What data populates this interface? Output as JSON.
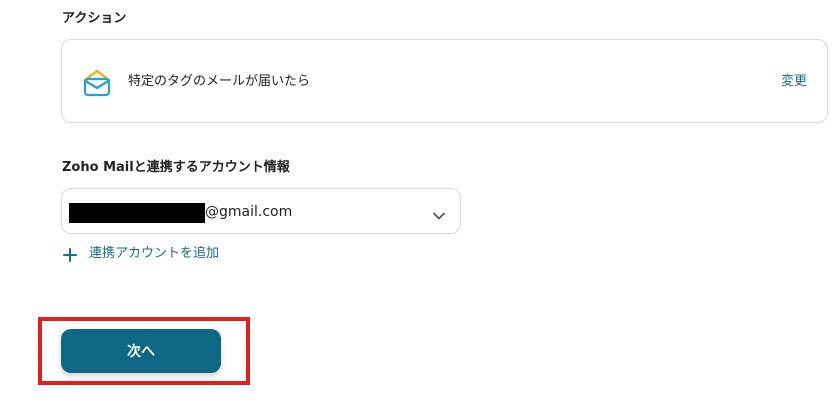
{
  "action_section": {
    "title": "アクション",
    "card": {
      "icon": "zoho-mail-envelope-icon",
      "text": "特定のタグのメールが届いたら",
      "change_label": "変更"
    }
  },
  "account_section": {
    "title": "Zoho Mailと連携するアカウント情報",
    "selected_email_suffix": "@gmail.com",
    "add_account_label": "連携アカウントを追加"
  },
  "footer": {
    "next_label": "次へ"
  },
  "colors": {
    "accent": "#1a6d86",
    "button": "#0e6785",
    "highlight": "#e0201c",
    "border": "#d7dbe0"
  }
}
